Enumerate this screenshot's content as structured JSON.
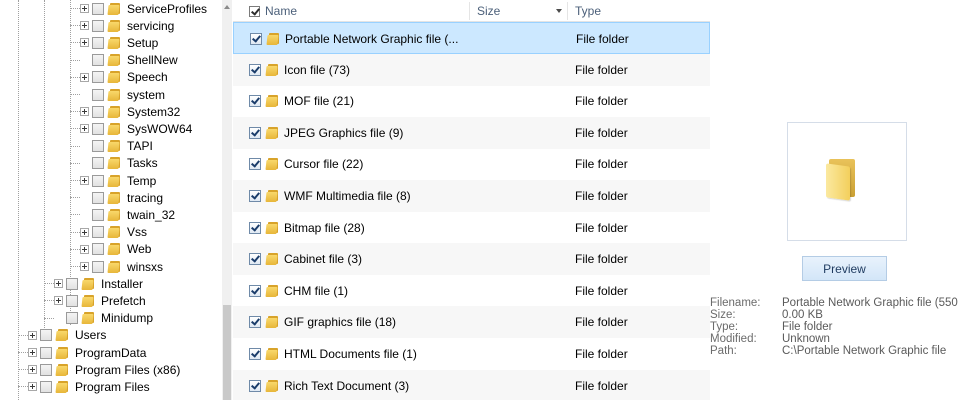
{
  "tree": {
    "nodes": [
      {
        "label": "ServiceProfiles",
        "has_children": true
      },
      {
        "label": "servicing",
        "has_children": true
      },
      {
        "label": "Setup",
        "has_children": true
      },
      {
        "label": "ShellNew",
        "has_children": false
      },
      {
        "label": "Speech",
        "has_children": true
      },
      {
        "label": "system",
        "has_children": false
      },
      {
        "label": "System32",
        "has_children": true
      },
      {
        "label": "SysWOW64",
        "has_children": true
      },
      {
        "label": "TAPI",
        "has_children": false
      },
      {
        "label": "Tasks",
        "has_children": false
      },
      {
        "label": "Temp",
        "has_children": true
      },
      {
        "label": "tracing",
        "has_children": false
      },
      {
        "label": "twain_32",
        "has_children": false
      },
      {
        "label": "Vss",
        "has_children": true
      },
      {
        "label": "Web",
        "has_children": true
      },
      {
        "label": "winsxs",
        "has_children": true
      },
      {
        "label": "Installer",
        "has_children": true
      },
      {
        "label": "Prefetch",
        "has_children": true
      },
      {
        "label": "Minidump",
        "has_children": false
      },
      {
        "label": "Users",
        "has_children": true
      },
      {
        "label": "ProgramData",
        "has_children": true
      },
      {
        "label": "Program Files (x86)",
        "has_children": true
      },
      {
        "label": "Program Files",
        "has_children": true
      }
    ]
  },
  "list": {
    "columns": {
      "name": "Name",
      "size": "Size",
      "type": "Type"
    },
    "rows": [
      {
        "name": "Portable Network Graphic file (...",
        "type": "File folder",
        "selected": true
      },
      {
        "name": "Icon file (73)",
        "type": "File folder"
      },
      {
        "name": "MOF file (21)",
        "type": "File folder"
      },
      {
        "name": "JPEG Graphics file (9)",
        "type": "File folder"
      },
      {
        "name": "Cursor file (22)",
        "type": "File folder"
      },
      {
        "name": "WMF Multimedia file (8)",
        "type": "File folder"
      },
      {
        "name": "Bitmap file (28)",
        "type": "File folder"
      },
      {
        "name": "Cabinet file (3)",
        "type": "File folder"
      },
      {
        "name": "CHM file (1)",
        "type": "File folder"
      },
      {
        "name": "GIF graphics file (18)",
        "type": "File folder"
      },
      {
        "name": "HTML Documents file (1)",
        "type": "File folder"
      },
      {
        "name": "Rich Text Document (3)",
        "type": "File folder"
      }
    ]
  },
  "preview": {
    "button_label": "Preview",
    "info": [
      {
        "label": "Filename:",
        "value": "Portable Network Graphic file (550"
      },
      {
        "label": "Size:",
        "value": "0.00 KB"
      },
      {
        "label": "Type:",
        "value": "File folder"
      },
      {
        "label": "Modified:",
        "value": "Unknown"
      },
      {
        "label": "Path:",
        "value": "C:\\Portable Network Graphic file"
      }
    ]
  },
  "colors": {
    "selection_bg": "#cce8ff",
    "selection_border": "#99d1ff",
    "header_text": "#4c607a",
    "alt_row": "#f7f7f7"
  }
}
